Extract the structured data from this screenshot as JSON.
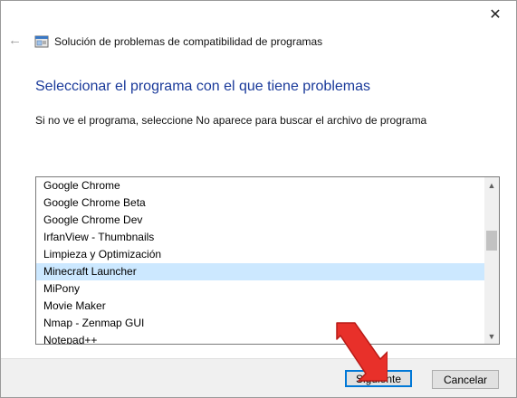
{
  "window": {
    "title": "Solución de problemas de compatibilidad de programas",
    "close_label": "✕",
    "back_label": "←"
  },
  "main": {
    "heading": "Seleccionar el programa con el que tiene problemas",
    "instruction": "Si no ve el programa, seleccione No aparece para buscar el archivo de programa"
  },
  "program_list": {
    "items": [
      "Google Chrome",
      "Google Chrome Beta",
      "Google Chrome Dev",
      "IrfanView - Thumbnails",
      "Limpieza y Optimización",
      "Minecraft Launcher",
      "MiPony",
      "Movie Maker",
      "Nmap - Zenmap GUI",
      "Notepad++"
    ],
    "selected": "Minecraft Launcher",
    "scroll_up": "▲",
    "scroll_down": "▼"
  },
  "footer": {
    "next_label": "Siguiente",
    "cancel_label": "Cancelar"
  },
  "colors": {
    "heading": "#1a3a9a",
    "selection": "#cce8ff",
    "primary_border": "#0078d7",
    "annotation_arrow": "#e8302a"
  },
  "icons": {
    "back": "back-arrow-icon",
    "app": "compatibility-troubleshooter-icon",
    "close": "close-icon",
    "annotation": "red-pointer-arrow-icon"
  }
}
